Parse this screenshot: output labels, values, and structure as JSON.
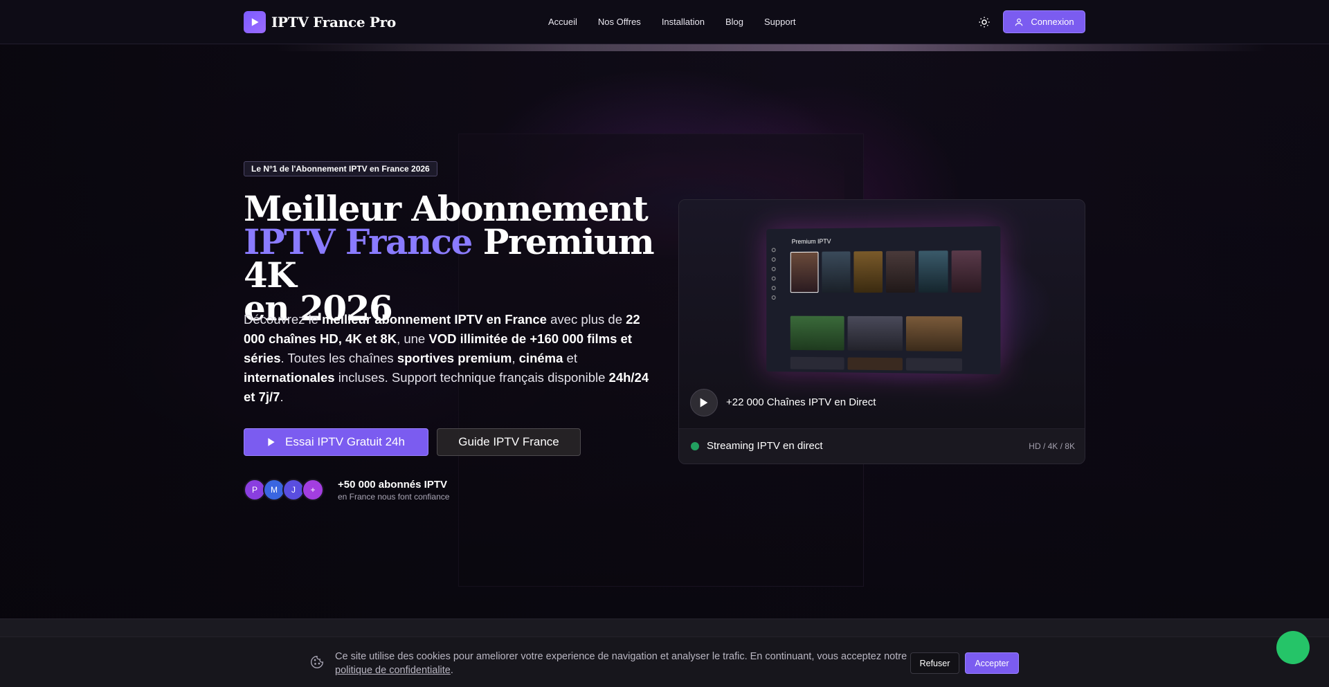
{
  "colors": {
    "accent": "#7b5cf0",
    "accent_text": "#8a7bff",
    "live_dot": "#22a060",
    "whatsapp": "#25c468"
  },
  "header": {
    "logo_text": "IPTV France Pro",
    "nav": [
      "Accueil",
      "Nos Offres",
      "Installation",
      "Blog",
      "Support"
    ],
    "theme_icon": "sun-icon",
    "login_label": "Connexion"
  },
  "hero": {
    "badge": "Le N°1 de l'Abonnement IPTV en France 2026",
    "title_line1": "Meilleur Abonnement",
    "title_accent": "IPTV France",
    "title_line2_rest": " Premium 4K",
    "title_line3": "en 2026",
    "desc": {
      "t1": "Découvrez le ",
      "b1": "meilleur abonnement IPTV en France",
      "t2": " avec plus de ",
      "b2": "22 000 chaînes HD, 4K et 8K",
      "t3": ", une ",
      "b3": "VOD illimitée de +160 000 films et séries",
      "t4": ". Toutes les chaînes ",
      "b4": "sportives premium",
      "t5": ", ",
      "b5": "cinéma",
      "t6": " et ",
      "b6": "internationales",
      "t7": " incluses. Support technique français disponible ",
      "b7": "24h/24 et 7j/7",
      "t8": "."
    },
    "cta_primary": "Essai IPTV Gratuit 24h",
    "cta_secondary": "Guide IPTV France",
    "avatars": [
      "P",
      "M",
      "J",
      "+"
    ],
    "trust_title": "+50 000 abonnés IPTV",
    "trust_sub": "en France nous font confiance"
  },
  "video_card": {
    "screen_title": "Premium IPTV",
    "play_label": "+22 000 Chaînes IPTV en Direct",
    "status": "Streaming IPTV en direct",
    "quality": "HD / 4K / 8K"
  },
  "cookie": {
    "text": "Ce site utilise des cookies pour ameliorer votre experience de navigation et analyser le trafic. En continuant, vous acceptez notre ",
    "link": "politique de confidentialite",
    "end": ".",
    "refuse": "Refuser",
    "accept": "Accepter"
  }
}
